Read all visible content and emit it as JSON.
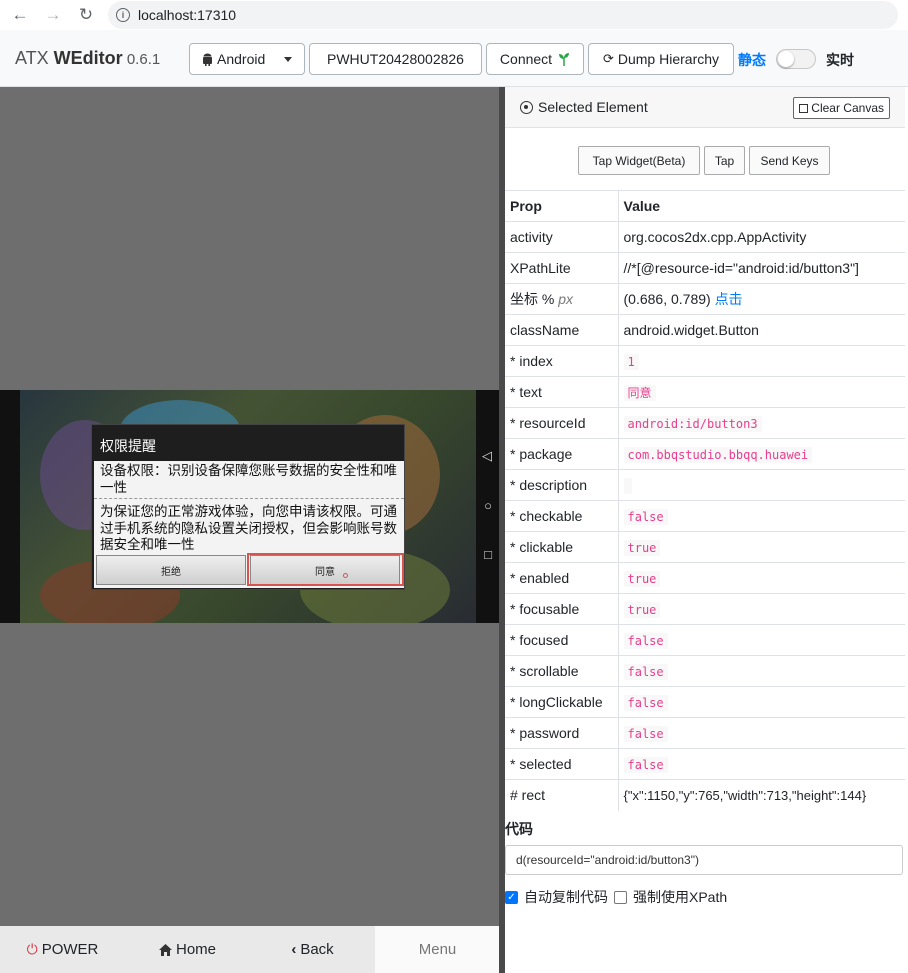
{
  "browser": {
    "url": "localhost:17310",
    "back_icon": "←",
    "forward_icon": "→",
    "reload_icon": "↻",
    "info_icon": "i"
  },
  "header": {
    "brand_prefix": "ATX ",
    "brand_name": "WEditor",
    "version": " 0.6.1",
    "platform": "Android",
    "device_serial": "PWHUT20428002826",
    "connect_label": "Connect",
    "dump_label": "Dump Hierarchy",
    "static_label": "静态",
    "realtime_label": "实时",
    "realtime_enabled": false,
    "accent_color": "#007bff"
  },
  "device": {
    "dialog_title": "权限提醒",
    "message_1": "设备权限：识别设备保障您账号数据的安全性和唯一性",
    "message_2": "为保证您的正常游戏体验，向您申请该权限。可通过手机系统的隐私设置关闭授权，但会影响账号数据安全和唯一性",
    "deny_label": "拒绝",
    "agree_label": "同意",
    "nav_back": "◁",
    "nav_home": "○",
    "nav_recent": "□",
    "highlight_color": "#d9534f"
  },
  "bottom_bar": {
    "power": "POWER",
    "home": "Home",
    "back": "Back",
    "menu": "Menu"
  },
  "inspector": {
    "title": "Selected Element",
    "clear_canvas": "Clear Canvas",
    "tap_widget": "Tap Widget(Beta)",
    "tap": "Tap",
    "send_keys": "Send Keys",
    "col_prop": "Prop",
    "col_value": "Value",
    "activity_label": "activity",
    "activity": "org.cocos2dx.cpp.AppActivity",
    "xpath_label": "XPathLite",
    "xpath": "//*[@resource-id=\"android:id/button3\"]",
    "coord_label": "坐标 %",
    "coord_px": "px",
    "coord_value": "(0.686, 0.789)",
    "coord_click": "点击",
    "classname_label": "className",
    "classname": "android.widget.Button",
    "props": [
      {
        "name": "* index",
        "value": "1"
      },
      {
        "name": "* text",
        "value": "同意"
      },
      {
        "name": "* resourceId",
        "value": "android:id/button3"
      },
      {
        "name": "* package",
        "value": "com.bbqstudio.bbqq.huawei"
      },
      {
        "name": "* description",
        "value": ""
      },
      {
        "name": "* checkable",
        "value": "false"
      },
      {
        "name": "* clickable",
        "value": "true"
      },
      {
        "name": "* enabled",
        "value": "true"
      },
      {
        "name": "* focusable",
        "value": "true"
      },
      {
        "name": "* focused",
        "value": "false"
      },
      {
        "name": "* scrollable",
        "value": "false"
      },
      {
        "name": "* longClickable",
        "value": "false"
      },
      {
        "name": "* password",
        "value": "false"
      },
      {
        "name": "* selected",
        "value": "false"
      }
    ],
    "rect_label": "# rect",
    "rect": "{\"x\":1150,\"y\":765,\"width\":713,\"height\":144}",
    "code_label": "代码",
    "code": "d(resourceId=\"android:id/button3\")",
    "auto_copy_label": "自动复制代码",
    "auto_copy_checked": true,
    "force_xpath_label": "强制使用XPath",
    "force_xpath_checked": false
  }
}
